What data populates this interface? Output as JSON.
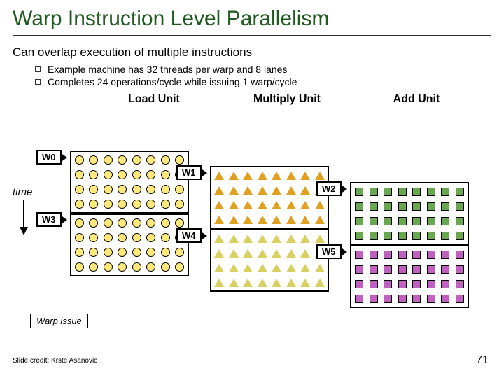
{
  "title": "Warp Instruction Level Parallelism",
  "subtitle": "Can overlap execution of multiple instructions",
  "bullets": [
    "Example machine has 32 threads per warp and 8 lanes",
    "Completes 24 operations/cycle while issuing 1 warp/cycle"
  ],
  "units": {
    "load": "Load Unit",
    "mul": "Multiply Unit",
    "add": "Add Unit"
  },
  "warps": {
    "w0": "W0",
    "w1": "W1",
    "w2": "W2",
    "w3": "W3",
    "w4": "W4",
    "w5": "W5"
  },
  "time_label": "time",
  "warp_issue": "Warp issue",
  "credit": "Slide credit: Krste Asanovic",
  "page": "71"
}
